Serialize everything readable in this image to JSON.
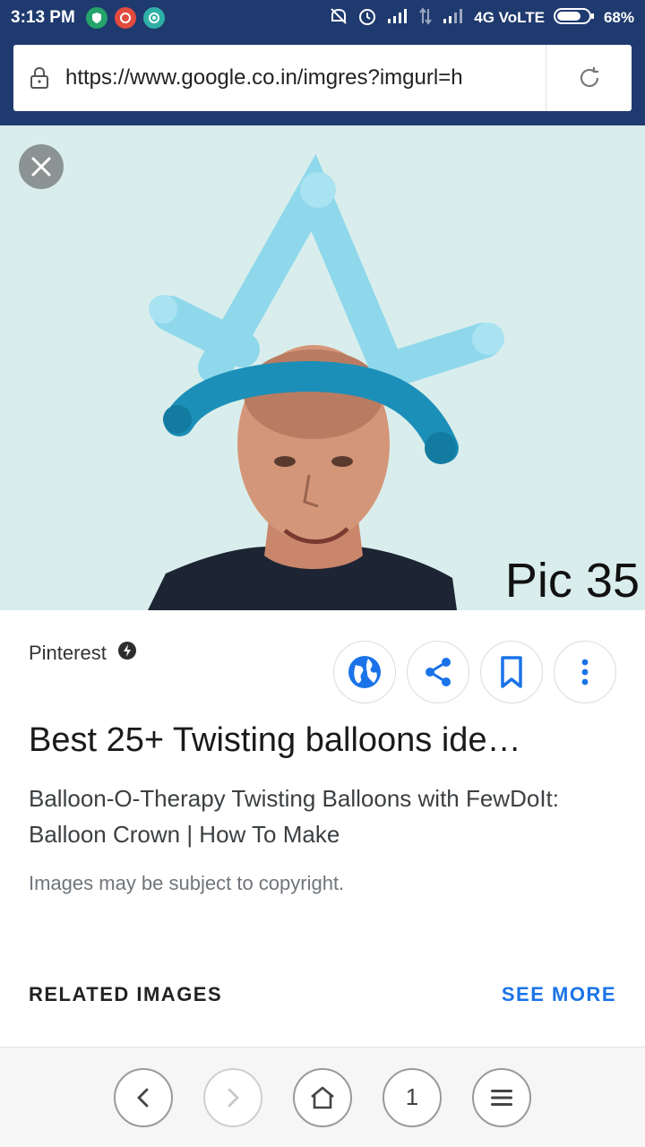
{
  "statusbar": {
    "time": "3:13 PM",
    "network": "4G VoLTE",
    "battery": "68%"
  },
  "browser": {
    "url": "https://www.google.co.in/imgres?imgurl=h"
  },
  "image": {
    "overlay_text": "Pic 35"
  },
  "result": {
    "source": "Pinterest",
    "title": "Best 25+ Twisting balloons ide…",
    "description": "Balloon-O-Therapy Twisting Balloons with FewDoIt: Balloon Crown | How To Make",
    "copyright": "Images may be subject to copyright."
  },
  "related": {
    "label": "RELATED IMAGES",
    "see_more": "SEE MORE"
  },
  "nav": {
    "tabs_count": "1"
  },
  "colors": {
    "statusbar": "#1f3a6e",
    "accent": "#1a73e8"
  }
}
